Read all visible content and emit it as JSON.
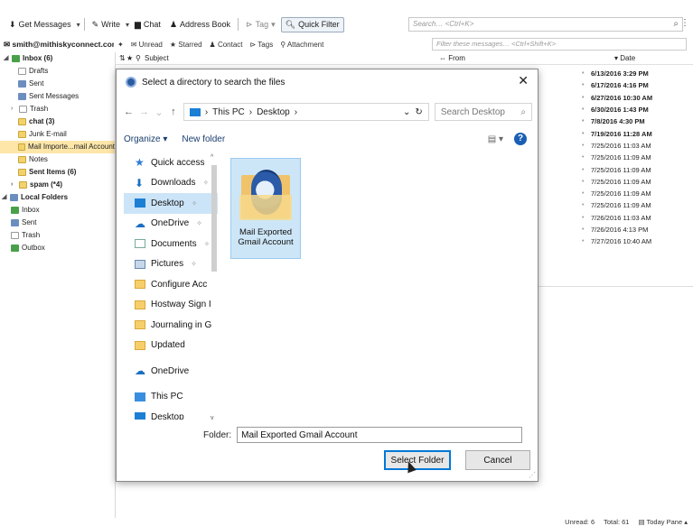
{
  "toolbar": {
    "get_messages": "Get Messages",
    "write": "Write",
    "chat": "Chat",
    "address_book": "Address Book",
    "tag": "Tag",
    "quick_filter": "Quick Filter",
    "search_placeholder": "Search… <Ctrl+K>"
  },
  "account": {
    "name": "smith@mithiskyconnect.com"
  },
  "quick_filter_bar": {
    "unread": "Unread",
    "starred": "Starred",
    "contact": "Contact",
    "tags": "Tags",
    "attachment": "Attachment",
    "filter_placeholder": "Filter these messages… <Ctrl+Shift+K>"
  },
  "folders": [
    {
      "label": "Inbox (6)",
      "bold": true
    },
    {
      "label": "Drafts"
    },
    {
      "label": "Sent"
    },
    {
      "label": "Sent Messages"
    },
    {
      "label": "Trash"
    },
    {
      "label": "chat (3)",
      "bold": true
    },
    {
      "label": "Junk E-mail"
    },
    {
      "label": "Mail Importe...mail Account",
      "selected": true
    },
    {
      "label": "Notes"
    },
    {
      "label": "Sent Items (6)",
      "bold": true
    },
    {
      "label": "spam (*4)",
      "bold": true
    },
    {
      "label": "Local Folders",
      "bold": true
    },
    {
      "label": "Inbox"
    },
    {
      "label": "Sent"
    },
    {
      "label": "Trash"
    },
    {
      "label": "Outbox"
    }
  ],
  "message_list": {
    "subject_header": "Subject",
    "from_header": "From",
    "date_header": "Date",
    "dates": [
      {
        "value": "6/13/2016 3:29 PM",
        "bold": true
      },
      {
        "value": "6/17/2016 4:16 PM",
        "bold": true
      },
      {
        "value": "6/27/2016 10:30 AM",
        "bold": true
      },
      {
        "value": "6/30/2016 1:43 PM",
        "bold": true
      },
      {
        "value": "7/8/2016 4:30 PM",
        "bold": true
      },
      {
        "value": "7/19/2016 11:28 AM",
        "bold": true
      },
      {
        "value": "7/25/2016 11:03 AM"
      },
      {
        "value": "7/25/2016 11:09 AM"
      },
      {
        "value": "7/25/2016 11:09 AM"
      },
      {
        "value": "7/25/2016 11:09 AM"
      },
      {
        "value": "7/25/2016 11:09 AM"
      },
      {
        "value": "7/25/2016 11:09 AM"
      },
      {
        "value": "7/26/2016 11:03 AM"
      },
      {
        "value": "7/26/2016 4:13 PM"
      },
      {
        "value": "7/27/2016 10:40 AM"
      }
    ]
  },
  "dialog": {
    "title": "Select a directory to search the files",
    "path_this_pc": "This PC",
    "path_desktop": "Desktop",
    "search_placeholder": "Search Desktop",
    "organize": "Organize",
    "new_folder": "New folder",
    "nav_items": [
      {
        "label": "Quick access",
        "icon": "star"
      },
      {
        "label": "Downloads",
        "icon": "down",
        "pinned": true
      },
      {
        "label": "Desktop",
        "icon": "desk",
        "pinned": true,
        "selected": true
      },
      {
        "label": "OneDrive",
        "icon": "cloud",
        "pinned": true
      },
      {
        "label": "Documents",
        "icon": "doc",
        "pinned": true
      },
      {
        "label": "Pictures",
        "icon": "pic",
        "pinned": true
      },
      {
        "label": "Configure Acc",
        "icon": "folder"
      },
      {
        "label": "Hostway Sign I",
        "icon": "folder"
      },
      {
        "label": "Journaling in G",
        "icon": "folder"
      },
      {
        "label": "Updated",
        "icon": "folder"
      },
      {
        "label": "OneDrive",
        "icon": "cloud",
        "gap": true
      },
      {
        "label": "This PC",
        "icon": "pc",
        "gap": true
      },
      {
        "label": "Desktop",
        "icon": "desk"
      }
    ],
    "file_item_label": "Mail Exported Gmail Account",
    "folder_label": "Folder:",
    "folder_value": "Mail Exported Gmail Account",
    "select_folder": "Select Folder",
    "cancel": "Cancel"
  },
  "status": {
    "unread": "Unread: 6",
    "total": "Total: 61",
    "today_pane": "Today Pane"
  }
}
